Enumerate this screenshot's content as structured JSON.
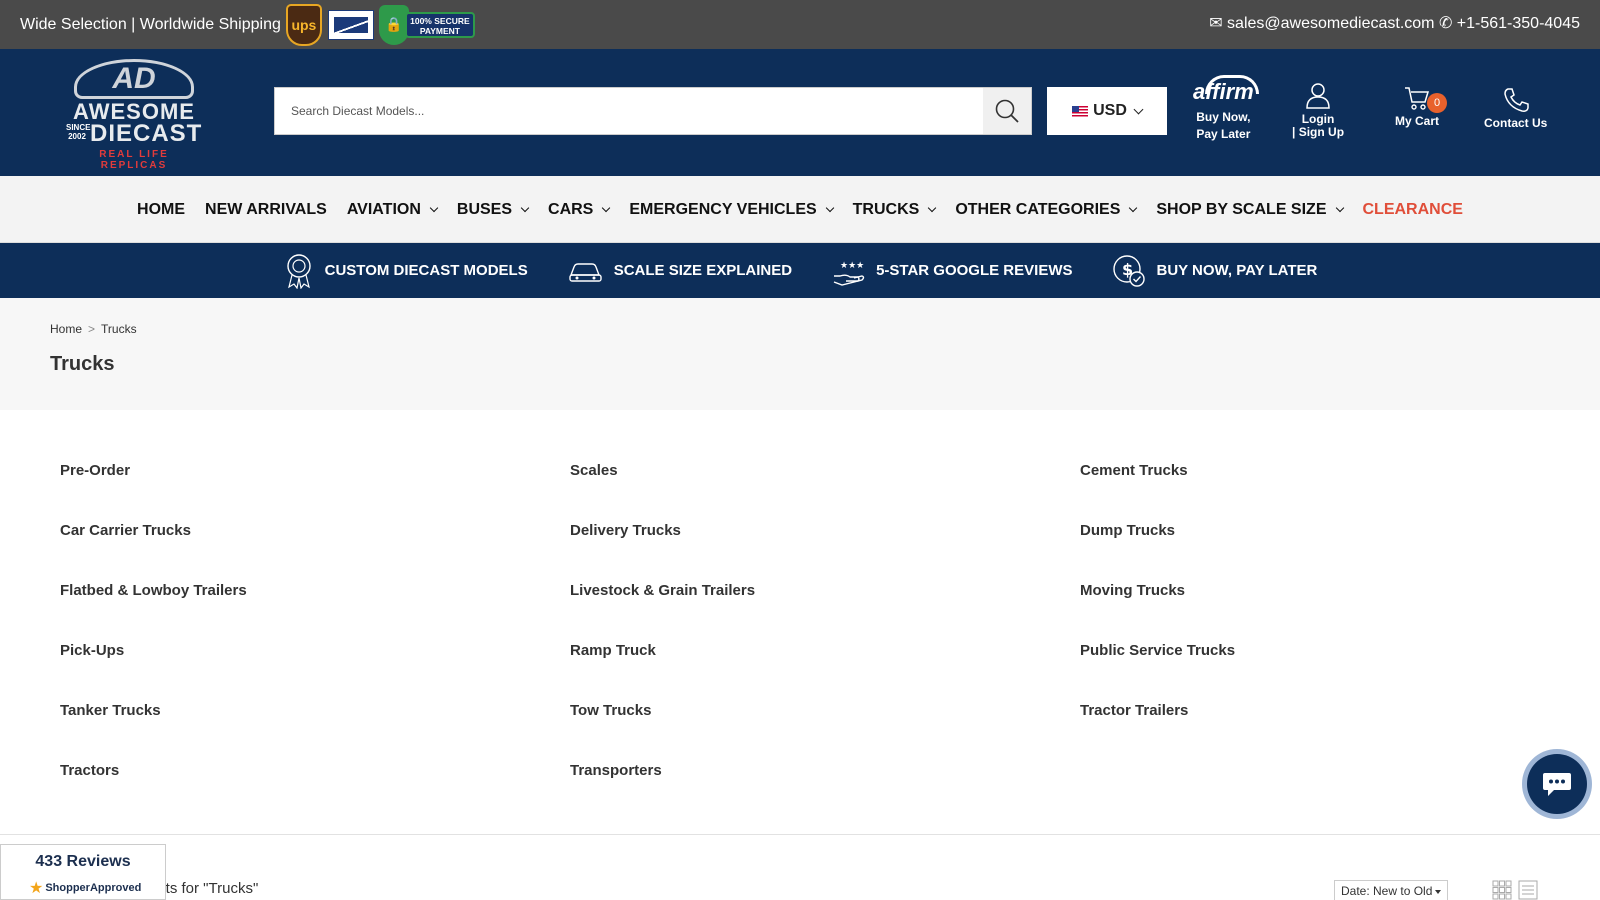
{
  "topbar": {
    "tagline": "Wide Selection | Worldwide Shipping",
    "badges": {
      "ups": "ups",
      "secure_line1": "100% SECURE",
      "secure_line2": "PAYMENT"
    },
    "contact": "✉ sales@awesomediecast.com ✆ +1-561-350-4045"
  },
  "logo": {
    "initials": "AD",
    "line1": "AWESOME",
    "since": "SINCE 2002",
    "line2": "DIECAST",
    "tagline": "REAL LIFE REPLICAS"
  },
  "search": {
    "placeholder": "Search Diecast Models...",
    "value": "",
    "icon": "search-icon"
  },
  "currency": {
    "selected": "USD"
  },
  "header_actions": {
    "affirm": {
      "logo": "affirm",
      "line1": "Buy Now,",
      "line2": "Pay Later"
    },
    "account": {
      "line1": "Login",
      "line2": "| Sign Up",
      "icon": "user-icon"
    },
    "cart": {
      "label": "My Cart",
      "count": "0",
      "icon": "cart-icon"
    },
    "contact": {
      "label": "Contact Us",
      "icon": "phone-icon"
    }
  },
  "nav": {
    "items": [
      {
        "label": "HOME",
        "dropdown": false
      },
      {
        "label": "NEW ARRIVALS",
        "dropdown": false
      },
      {
        "label": "AVIATION",
        "dropdown": true
      },
      {
        "label": "BUSES",
        "dropdown": true
      },
      {
        "label": "CARS",
        "dropdown": true
      },
      {
        "label": "EMERGENCY VEHICLES",
        "dropdown": true
      },
      {
        "label": "TRUCKS",
        "dropdown": true
      },
      {
        "label": "OTHER CATEGORIES",
        "dropdown": true
      },
      {
        "label": "SHOP BY SCALE SIZE",
        "dropdown": true
      },
      {
        "label": "CLEARANCE",
        "dropdown": false
      }
    ],
    "clearance_color": "#e04e39"
  },
  "features": [
    {
      "label": "CUSTOM DIECAST MODELS",
      "icon": "award-ribbon-icon"
    },
    {
      "label": "SCALE SIZE EXPLAINED",
      "icon": "car-scale-icon"
    },
    {
      "label": "5-STAR GOOGLE REVIEWS",
      "icon": "hand-stars-icon"
    },
    {
      "label": "BUY NOW, PAY LATER",
      "icon": "dollar-check-icon"
    }
  ],
  "breadcrumb": {
    "home": "Home",
    "separator": ">",
    "current": "Trucks"
  },
  "page": {
    "title": "Trucks"
  },
  "subcategories": {
    "col1": [
      "Pre-Order",
      "Car Carrier Trucks",
      "Flatbed & Lowboy Trailers",
      "Pick-Ups",
      "Tanker Trucks",
      "Tractors"
    ],
    "col2": [
      "Scales",
      "Delivery Trucks",
      "Livestock & Grain Trailers",
      "Ramp Truck",
      "Tow Trucks",
      "Transporters"
    ],
    "col3": [
      "Cement Trucks",
      "Dump Trucks",
      "Moving Trucks",
      "Public Service Trucks",
      "Tractor Trailers"
    ]
  },
  "results": {
    "text": "ults for \"Trucks\""
  },
  "sort": {
    "selected": "Date: New to Old"
  },
  "reviews_widget": {
    "count": "433 Reviews",
    "brand": "ShopperApproved"
  },
  "colors": {
    "navy": "#0d2e59",
    "topbar": "#4a4a4a",
    "accent": "#e8612c"
  }
}
